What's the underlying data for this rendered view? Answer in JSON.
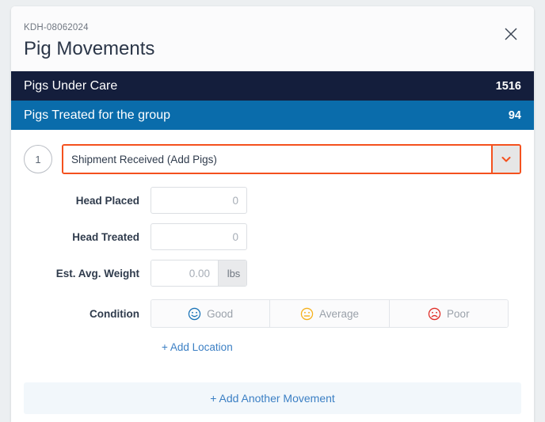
{
  "header": {
    "subtitle": "KDH-08062024",
    "title": "Pig Movements",
    "close_icon": "close-icon"
  },
  "stats": [
    {
      "label": "Pigs Under Care",
      "value": "1516",
      "color": "#141e3c"
    },
    {
      "label": "Pigs Treated for the group",
      "value": "94",
      "color": "#0a6cab"
    }
  ],
  "movement": {
    "step_number": "1",
    "type_select": {
      "value": "Shipment Received (Add Pigs)",
      "chevron_icon": "chevron-down-icon",
      "border_color": "#f4511e"
    },
    "fields": [
      {
        "label": "Head Placed",
        "value": "",
        "placeholder": "0",
        "unit": ""
      },
      {
        "label": "Head Treated",
        "value": "",
        "placeholder": "0",
        "unit": ""
      },
      {
        "label": "Est. Avg. Weight",
        "value": "",
        "placeholder": "0.00",
        "unit": "lbs"
      }
    ],
    "condition": {
      "label": "Condition",
      "options": [
        {
          "label": "Good",
          "icon": "smiley-happy-icon",
          "color": "#1a73b7"
        },
        {
          "label": "Average",
          "icon": "smiley-neutral-icon",
          "color": "#f5b01a"
        },
        {
          "label": "Poor",
          "icon": "smiley-sad-icon",
          "color": "#e02d27"
        }
      ]
    },
    "add_location_label": "+ Add Location"
  },
  "footer": {
    "add_movement_label": "+ Add Another Movement"
  }
}
